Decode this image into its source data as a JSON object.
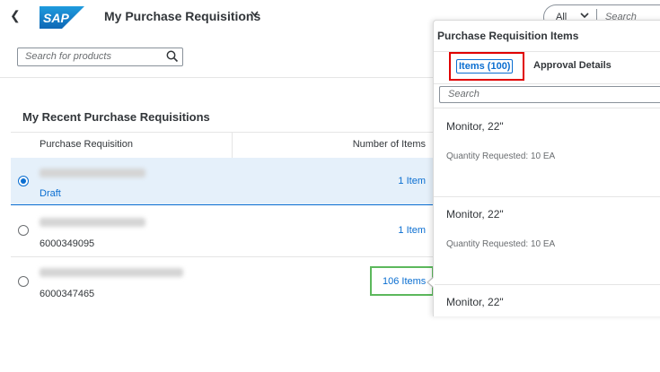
{
  "shell": {
    "logo_text": "SAP",
    "app_title": "My Purchase Requisitions",
    "scope_value": "All",
    "search_placeholder": "Search"
  },
  "product_search": {
    "placeholder": "Search for products"
  },
  "section": {
    "title": "My Recent Purchase Requisitions"
  },
  "table": {
    "headers": [
      "Purchase Requisition",
      "Number of Items"
    ],
    "rows": [
      {
        "id": "Draft",
        "count": "1 Item",
        "selected": true
      },
      {
        "id": "6000349095",
        "count": "1 Item",
        "selected": false
      },
      {
        "id": "6000347465",
        "count": "106 Items",
        "selected": false
      }
    ]
  },
  "popover": {
    "title": "Purchase Requisition Items",
    "tabs": [
      "Items (100)",
      "Approval Details"
    ],
    "search_placeholder": "Search",
    "items": [
      {
        "name": "Monitor, 22\"",
        "quantity": "Quantity Requested: 10 EA"
      },
      {
        "name": "Monitor, 22\"",
        "quantity": "Quantity Requested: 10 EA"
      },
      {
        "name": "Monitor, 22\"",
        "quantity": ""
      }
    ]
  },
  "colors": {
    "brand_blue": "#0a6ed1",
    "selected_row": "#e5f0fa",
    "highlight_red": "#e00000",
    "highlight_green": "#5cb85c"
  },
  "icons": [
    "back-arrow-icon",
    "sap-logo",
    "chevron-down-icon",
    "search-icon"
  ]
}
